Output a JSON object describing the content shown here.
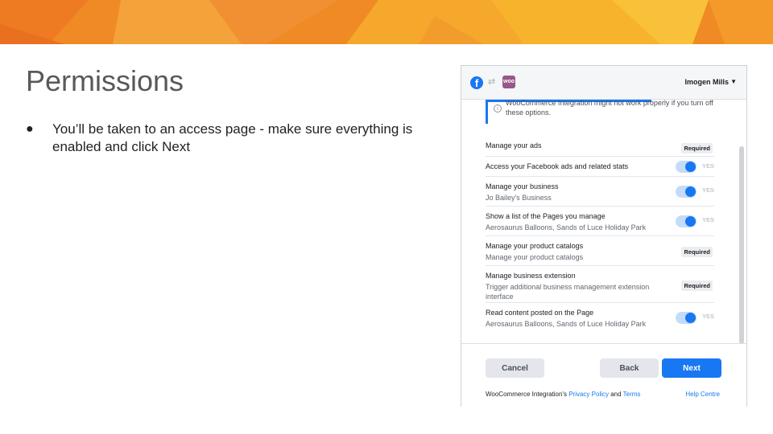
{
  "slide": {
    "title": "Permissions",
    "bullet_marker": "●",
    "bullet": "You’ll be taken to an access page - make sure everything is enabled and click Next"
  },
  "colors": {
    "accent": "#1877f2",
    "banner_orange": "#f08a24",
    "banner_yellow": "#f7b32b"
  },
  "fb": {
    "user_name": "Imogen Mills",
    "icons": {
      "facebook": "f",
      "woo": "woo"
    },
    "warning_text": "WooCommerce Integration might not work properly if you turn off these options.",
    "permissions": [
      {
        "title": "Manage your ads",
        "subtitle": "",
        "control": "required",
        "badge": "Required"
      },
      {
        "title": "Access your Facebook ads and related stats",
        "subtitle": "",
        "control": "toggle",
        "state": "YES"
      },
      {
        "title": "Manage your business",
        "subtitle": "Jo Bailey's Business",
        "control": "toggle",
        "state": "YES"
      },
      {
        "title": "Show a list of the Pages you manage",
        "subtitle": "Aerosaurus Balloons, Sands of Luce Holiday Park",
        "control": "toggle",
        "state": "YES"
      },
      {
        "title": "Manage your product catalogs",
        "subtitle": "Manage your product catalogs",
        "control": "required",
        "badge": "Required"
      },
      {
        "title": "Manage business extension",
        "subtitle": "Trigger additional business management extension interface",
        "control": "required",
        "badge": "Required"
      },
      {
        "title": "Read content posted on the Page",
        "subtitle": "Aerosaurus Balloons, Sands of Luce Holiday Park",
        "control": "toggle",
        "state": "YES"
      }
    ],
    "buttons": {
      "cancel": "Cancel",
      "back": "Back",
      "next": "Next"
    },
    "footer": {
      "prefix": "WooCommerce Integration's ",
      "privacy": "Privacy Policy",
      "and": " and ",
      "terms": "Terms",
      "help": "Help Centre"
    }
  }
}
